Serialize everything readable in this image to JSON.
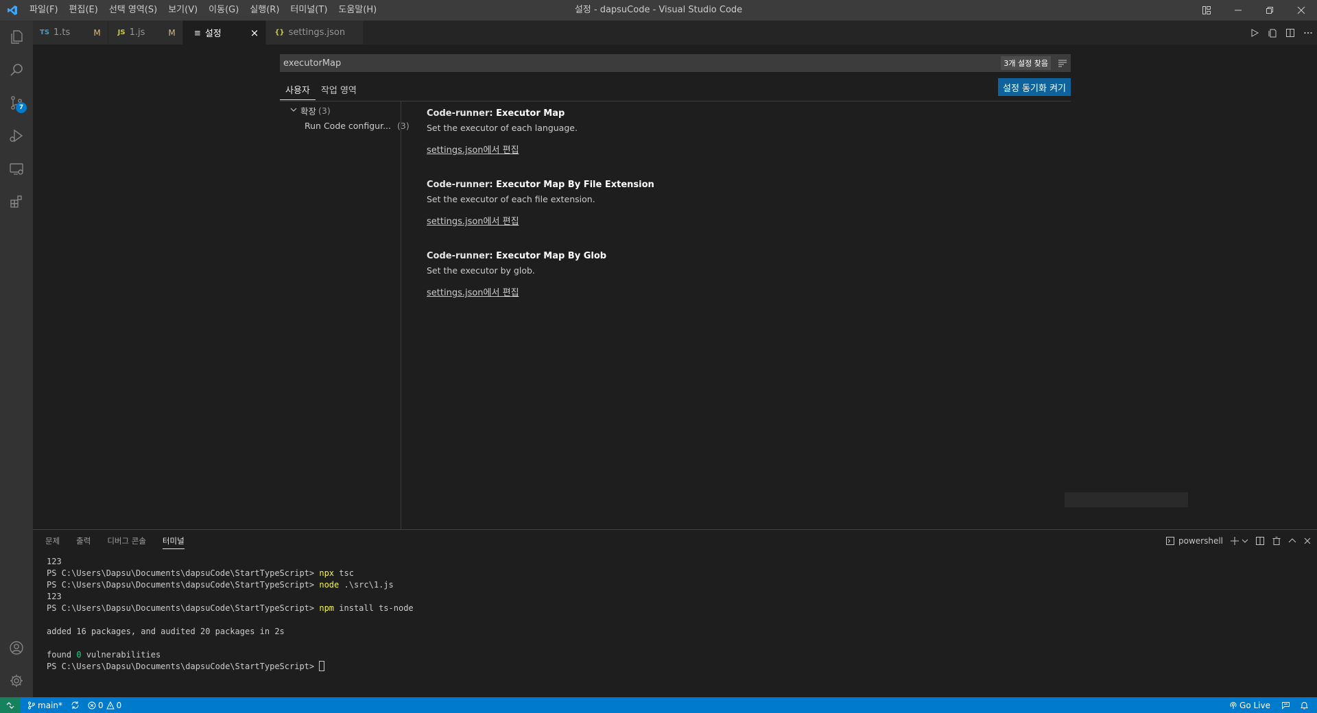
{
  "titlebar": {
    "menu": [
      "파일(F)",
      "편집(E)",
      "선택 영역(S)",
      "보기(V)",
      "이동(G)",
      "실행(R)",
      "터미널(T)",
      "도움말(H)"
    ],
    "window_title": "설정 - dapsuCode - Visual Studio Code"
  },
  "activity": {
    "scm_badge": "7"
  },
  "tabs": [
    {
      "icon": "TS",
      "icon_color": "#519aba",
      "label": "1.ts",
      "status": "M"
    },
    {
      "icon": "JS",
      "icon_color": "#cbcb41",
      "label": "1.js",
      "status": "M"
    },
    {
      "icon": "≡",
      "label": "설정",
      "close": "×"
    },
    {
      "icon": "{}",
      "icon_color": "#cbcb41",
      "label": "settings.json"
    }
  ],
  "settings": {
    "search_value": "executorMap",
    "result_count": "3개 설정 찾음",
    "scope_tabs": [
      "사용자",
      "작업 영역"
    ],
    "sync_button": "설정 동기화 켜기",
    "toc": [
      {
        "label": "확장",
        "count": "(3)"
      },
      {
        "label": "Run Code configur...",
        "count": "(3)"
      }
    ],
    "items": [
      {
        "category": "Code-runner: ",
        "name": "Executor Map",
        "description": "Set the executor of each language.",
        "link": "settings.json에서 편집"
      },
      {
        "category": "Code-runner: ",
        "name": "Executor Map By File Extension",
        "description": "Set the executor of each file extension.",
        "link": "settings.json에서 편집"
      },
      {
        "category": "Code-runner: ",
        "name": "Executor Map By Glob",
        "description": "Set the executor by glob.",
        "link": "settings.json에서 편집"
      }
    ]
  },
  "panel": {
    "tabs": [
      "문제",
      "출력",
      "디버그 콘솔",
      "터미널"
    ],
    "active_tab": 3,
    "terminal_name": "powershell",
    "prompt": "PS C:\\Users\\Dapsu\\Documents\\dapsuCode\\StartTypeScript> ",
    "lines": [
      {
        "type": "out",
        "text": "123"
      },
      {
        "type": "cmd",
        "command": "npx",
        "args": " tsc"
      },
      {
        "type": "cmd",
        "command": "node",
        "args": " .\\src\\1.js"
      },
      {
        "type": "out",
        "text": "123"
      },
      {
        "type": "cmd",
        "command": "npm",
        "args": " install ts-node"
      },
      {
        "type": "out",
        "text": ""
      },
      {
        "type": "out",
        "text": "added 16 packages, and audited 20 packages in 2s"
      },
      {
        "type": "out",
        "text": ""
      },
      {
        "type": "vuln",
        "before": "found ",
        "count": "0",
        "after": " vulnerabilities"
      },
      {
        "type": "prompt"
      }
    ]
  },
  "statusbar": {
    "branch": "main*",
    "errors": "0",
    "warnings": "0",
    "go_live": "Go Live"
  },
  "colors": {
    "accent": "#007acc",
    "remote": "#16825d",
    "button": "#0e639c",
    "modified": "#d7ba7d"
  }
}
